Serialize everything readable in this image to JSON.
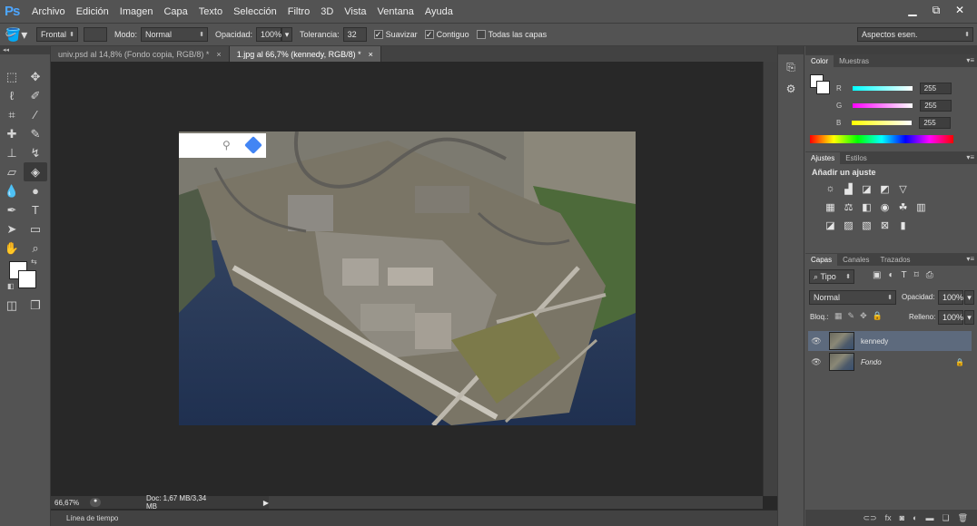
{
  "app": {
    "logo": "Ps"
  },
  "menu": [
    "Archivo",
    "Edición",
    "Imagen",
    "Capa",
    "Texto",
    "Selección",
    "Filtro",
    "3D",
    "Vista",
    "Ventana",
    "Ayuda"
  ],
  "window_controls": {
    "minimize": "▁",
    "restore": "⧉",
    "close": "✕"
  },
  "options": {
    "fill_source": "Frontal",
    "mode_label": "Modo:",
    "mode_value": "Normal",
    "opacity_label": "Opacidad:",
    "opacity_value": "100%",
    "tolerance_label": "Tolerancia:",
    "tolerance_value": "32",
    "antialias_label": "Suavizar",
    "contiguous_label": "Contiguo",
    "all_layers_label": "Todas las capas",
    "workspace": "Aspectos esen."
  },
  "tabs": [
    {
      "label": "univ.psd al 14,8% (Fondo copia, RGB/8) *",
      "close": "×"
    },
    {
      "label": "1.jpg al 66,7% (kennedy, RGB/8) *",
      "close": "×"
    }
  ],
  "status": {
    "zoom": "66,67%",
    "doc": "Doc: 1,67 MB/3,34 MB"
  },
  "timeline_label": "Línea de tiempo",
  "color_panel": {
    "tabs": [
      "Color",
      "Muestras"
    ],
    "r_label": "R",
    "g_label": "G",
    "b_label": "B",
    "r_value": "255",
    "g_value": "255",
    "b_value": "255"
  },
  "adjust_panel": {
    "tabs": [
      "Ajustes",
      "Estilos"
    ],
    "title": "Añadir un ajuste"
  },
  "layers_panel": {
    "tabs": [
      "Capas",
      "Canales",
      "Trazados"
    ],
    "filter_label": "Tipo",
    "blend_mode": "Normal",
    "opacity_label": "Opacidad:",
    "opacity_value": "100%",
    "lock_label": "Bloq.:",
    "fill_label": "Relleno:",
    "fill_value": "100%",
    "layers": [
      {
        "name": "kennedy",
        "selected": true
      },
      {
        "name": "Fondo",
        "selected": false,
        "locked": true
      }
    ]
  },
  "colors": {
    "foreground": "#ffffff",
    "background": "#ffffff",
    "selected_layer": "#5d6a7d"
  }
}
